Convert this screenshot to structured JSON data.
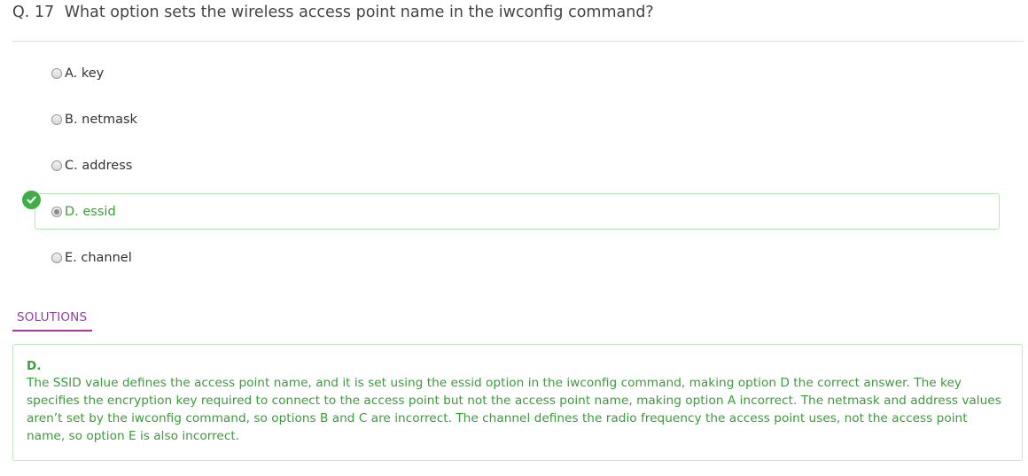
{
  "question": {
    "number": "Q. 17",
    "text": "What option sets the wireless access point name in the iwconfig command?"
  },
  "options": [
    {
      "label": "A. key",
      "selected": false,
      "correct": false
    },
    {
      "label": "B. netmask",
      "selected": false,
      "correct": false
    },
    {
      "label": "C. address",
      "selected": false,
      "correct": false
    },
    {
      "label": "D. essid",
      "selected": true,
      "correct": true
    },
    {
      "label": "E. channel",
      "selected": false,
      "correct": false
    }
  ],
  "correct_indicator_icon": "check-circle-icon",
  "solutions": {
    "tab_label": "SOLUTIONS",
    "answer": "D.",
    "explanation": "The SSID value defines the access point name, and it is set using the essid option in the iwconfig command, making option D the correct answer. The key specifies the encryption key required to connect to the access point but not the access point name, making option A incorrect. The netmask and address values aren’t set by the iwconfig command, so options B and C are incorrect. The channel defines the radio frequency the access point uses, not the access point name, so option E is also incorrect."
  },
  "colors": {
    "correct_green": "#3a9c3a",
    "badge_green": "#3fae4a",
    "solutions_purple": "#8f3fa3",
    "solutions_underline": "#b0358f"
  }
}
